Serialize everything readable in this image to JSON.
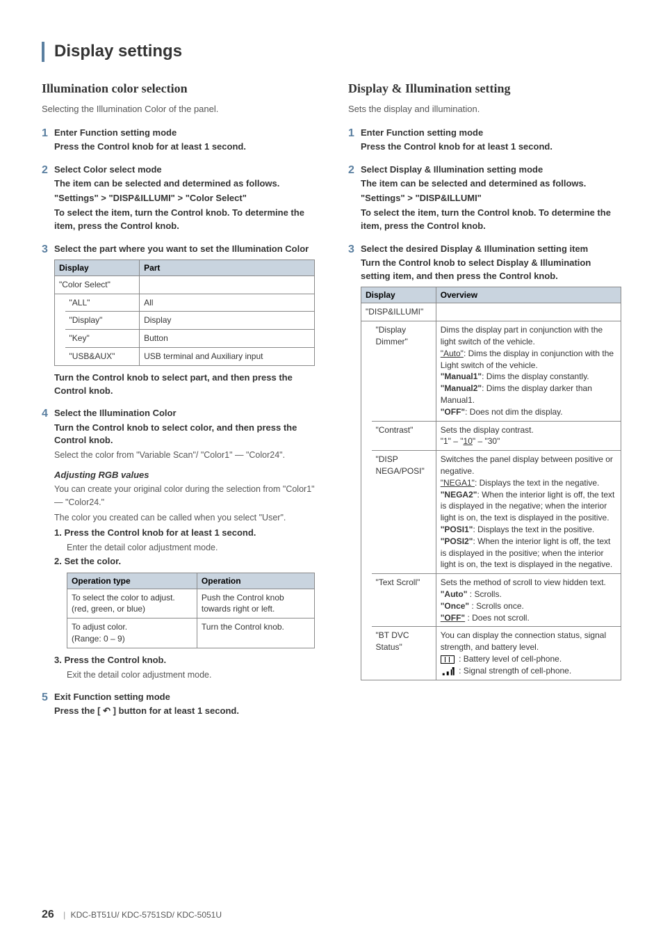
{
  "page": {
    "title": "Display settings"
  },
  "footer": {
    "page_num": "26",
    "models": "KDC-BT51U/ KDC-5751SD/ KDC-5051U"
  },
  "left": {
    "heading": "Illumination color selection",
    "intro": "Selecting the Illumination Color of the panel.",
    "steps": {
      "s1_head": "Enter Function setting mode",
      "s1_sub": "Press the Control knob for at least 1 second.",
      "s2_head": "Select Color select mode",
      "s2_sub1": "The item can be selected and determined as follows.",
      "s2_sub2a": "\"Settings\"",
      "s2_sub2b": "\"DISP&ILLUMI\"",
      "s2_sub2c": "\"Color Select\"",
      "s2_sub3": "To select the item, turn the Control knob. To determine the item, press the Control knob.",
      "s3_head": "Select the part where you want to set the Illumination Color",
      "s3_table": {
        "h1": "Display",
        "h2": "Part",
        "row0a": "\"Color Select\"",
        "r1a": "\"ALL\"",
        "r1b": "All",
        "r2a": "\"Display\"",
        "r2b": "Display",
        "r3a": "\"Key\"",
        "r3b": "Button",
        "r4a": "\"USB&AUX\"",
        "r4b": "USB terminal and Auxiliary input"
      },
      "s3_sub": "Turn the Control knob to select part, and then press the Control knob.",
      "s4_head": "Select the Illumination Color",
      "s4_sub": "Turn the Control knob to select color, and then press the Control knob.",
      "s4_note": "Select the color from \"Variable Scan\"/ \"Color1\" — \"Color24\".",
      "rgb_heading": "Adjusting RGB values",
      "rgb_p1": "You can create your original color during the selection from \"Color1\" — \"Color24.\"",
      "rgb_p2": "The color you created can be called when you select \"User\".",
      "rgb_1_head": "Press the Control knob for at least 1 second.",
      "rgb_1_note": "Enter the detail color adjustment mode.",
      "rgb_2_head": "Set the color.",
      "rgb_table": {
        "h1": "Operation type",
        "h2": "Operation",
        "r1a": "To select the color to adjust. (red, green, or blue)",
        "r1b": "Push the Control knob towards right or left.",
        "r2a": "To adjust color.\n(Range: 0 – 9)",
        "r2b": "Turn the Control knob."
      },
      "rgb_3_head": "Press the Control knob.",
      "rgb_3_note": "Exit the detail color adjustment mode.",
      "s5_head": "Exit Function setting mode",
      "s5_sub_a": "Press the [",
      "s5_sub_b": "] button for at least 1 second."
    }
  },
  "right": {
    "heading": "Display & Illumination setting",
    "intro": "Sets the display and illumination.",
    "steps": {
      "s1_head": "Enter Function setting mode",
      "s1_sub": "Press the Control knob for at least 1 second.",
      "s2_head": "Select Display & Illumination setting mode",
      "s2_sub1": "The item can be selected and determined as follows.",
      "s2_sub2a": "\"Settings\"",
      "s2_sub2b": "\"DISP&ILLUMI\"",
      "s2_sub3": "To select the item, turn the Control knob. To determine the item, press the Control knob.",
      "s3_head": "Select the desired Display & Illumination setting item",
      "s3_sub": "Turn the Control knob to select Display & Illumination setting item, and then press the Control knob.",
      "table": {
        "h1": "Display",
        "h2": "Overview",
        "row0a": "\"DISP&ILLUMI\"",
        "r1a": "\"Display Dimmer\"",
        "r1b_l1": "Dims the display part in conjunction with the light switch of the vehicle.",
        "r1b_auto_lbl": "\"Auto\"",
        "r1b_auto_txt": ": Dims the display in conjunction with the Light switch of the vehicle.",
        "r1b_m1_lbl": "\"Manual1\"",
        "r1b_m1_txt": ": Dims the display constantly.",
        "r1b_m2_lbl": "\"Manual2\"",
        "r1b_m2_txt": ": Dims the display darker than Manual1.",
        "r1b_off_lbl": "\"OFF\"",
        "r1b_off_txt": ": Does not dim the display.",
        "r2a": "\"Contrast\"",
        "r2b_l1": "Sets the display contrast.",
        "r2b_l2a": "\"1\" – \"",
        "r2b_l2u": "10",
        "r2b_l2b": "\" – \"30\"",
        "r3a": "\"DISP NEGA/POSI\"",
        "r3b_l1": "Switches the panel display between positive or negative.",
        "r3b_nega1_lbl": "\"NEGA1\"",
        "r3b_nega1_txt": ": Displays the text in the negative.",
        "r3b_nega2_lbl": "\"NEGA2\"",
        "r3b_nega2_txt": ": When the interior light is off, the text is displayed in the negative; when the interior light is on, the text is displayed in the positive.",
        "r3b_posi1_lbl": "\"POSI1\"",
        "r3b_posi1_txt": ": Displays the text in the positive.",
        "r3b_posi2_lbl": "\"POSI2\"",
        "r3b_posi2_txt": ": When the interior light is off, the text is displayed in the positive; when the interior light is on, the text is displayed in the negative.",
        "r4a": "\"Text Scroll\"",
        "r4b_l1": "Sets the method of scroll to view hidden text.",
        "r4b_auto_lbl": "\"Auto\"",
        "r4b_auto_txt": " : Scrolls.",
        "r4b_once_lbl": "\"Once\"",
        "r4b_once_txt": " : Scrolls once.",
        "r4b_off_lbl": "\"OFF\"",
        "r4b_off_txt": " : Does not scroll.",
        "r5a": "\"BT DVC Status\"",
        "r5b_l1": "You can display the connection status, signal strength, and battery level.",
        "r5b_batt": " : Battery level of cell-phone.",
        "r5b_sig": " : Signal strength of cell-phone."
      }
    }
  }
}
